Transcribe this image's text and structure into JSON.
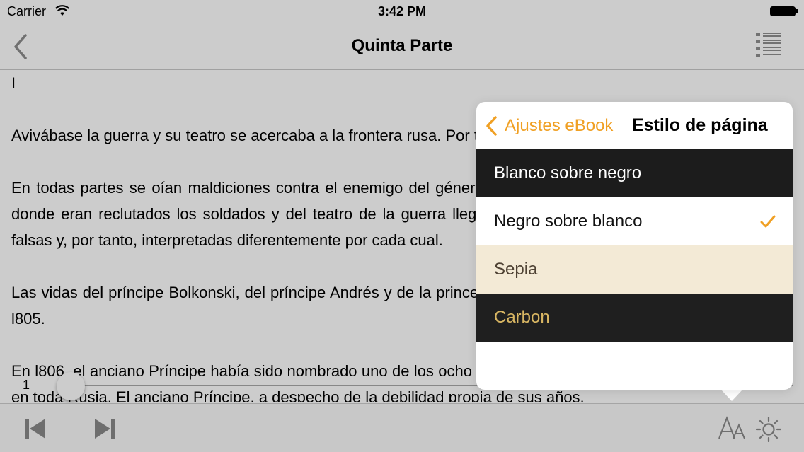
{
  "status_bar": {
    "carrier": "Carrier",
    "time": "3:42 PM",
    "icons": [
      "wifi-icon",
      "battery-icon"
    ]
  },
  "nav": {
    "title": "Quinta Parte",
    "back_icon": "chevron-left-icon",
    "toc_icon": "list-icon"
  },
  "content": {
    "paragraphs": [
      "I",
      "Avivábase la guerra y su teatro se acercaba a la frontera rusa. Por todas partes se oían maldiciones contra el enemigo del género humano: Bonaparte. En las aldeas, las gentes se preparaban para la guerra.",
      "En todas partes se oían maldiciones contra el enemigo del género humano, Bonaparte. Por todos los pueblos donde eran reclutados los soldados y del teatro de la guerra llegaban noticias contradictorias; como siempre; falsas y, por tanto, interpretadas diferentemente por cada cual.",
      "Las vidas del príncipe Bolkonski, del príncipe Andrés y de la princesa María habían cambiado mucho a partir de l805.",
      "En l806, el anciano Príncipe había sido nombrado uno de los ocho comandantes en jefe de las milicias formadas en toda Rusia. El anciano Príncipe, a despecho de la debilidad propia de sus años,"
    ]
  },
  "slider": {
    "page": "1",
    "progress": 0.0
  },
  "toolbar": {
    "icons": [
      "skip-back-icon",
      "skip-forward-icon",
      "font-size-icon",
      "brightness-icon"
    ]
  },
  "popover": {
    "back_label": "Ajustes eBook",
    "title": "Estilo de página",
    "options": [
      {
        "label": "Blanco sobre negro",
        "bg": "#1c1c1c",
        "fg": "#ffffff",
        "selected": false
      },
      {
        "label": "Negro sobre blanco",
        "bg": "#ffffff",
        "fg": "#111111",
        "selected": true
      },
      {
        "label": "Sepia",
        "bg": "#f3ead6",
        "fg": "#4e4234",
        "selected": false
      },
      {
        "label": "Carbon",
        "bg": "#1f1f1f",
        "fg": "#d8b663",
        "selected": false
      }
    ],
    "accent": "#f0a024"
  }
}
